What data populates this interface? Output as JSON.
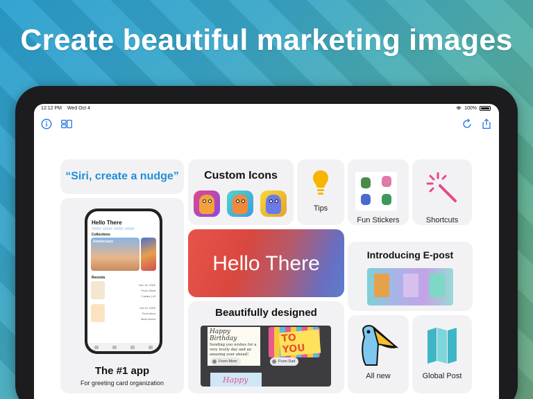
{
  "headline": "Create beautiful marketing images",
  "status": {
    "time": "12:12 PM",
    "date": "Wed Oct 4",
    "battery": "100%"
  },
  "toolbar": {
    "info": "info-icon",
    "sidebar": "sidebar-icon",
    "refresh": "refresh-icon",
    "share": "share-icon"
  },
  "cards": {
    "siri": {
      "text": "“Siri, create a nudge”"
    },
    "custom_icons": {
      "title": "Custom Icons"
    },
    "tips": {
      "label": "Tips"
    },
    "fun_stickers": {
      "label": "Fun Stickers"
    },
    "shortcuts": {
      "label": "Shortcuts"
    },
    "app": {
      "title": "The #1 app",
      "subtitle": "For greeting card organization"
    },
    "hello": {
      "text": "Hello There"
    },
    "epost": {
      "title": "Introducing E-post"
    },
    "designed": {
      "title": "Beautifully designed"
    },
    "all_new": {
      "label": "All new"
    },
    "global_post": {
      "label": "Global Post"
    }
  },
  "phone": {
    "title": "Hello There",
    "collections": "Collections",
    "anniversary": "Anniversary",
    "recents": "Recents",
    "date1": "Dec 10, 2022",
    "from1": "From Olivia",
    "meta1": "2 years | c3",
    "date2": "Oct 10, 2022",
    "from2": "From Mom",
    "meta2": "Most recent"
  },
  "design": {
    "bday_title": "Happy Birthday",
    "bday_body": "Sending you wishes for a very lovely day and an amazing year ahead!",
    "toyou": "TO YOU",
    "from_mom": "From Mom",
    "from_dad": "From Dad",
    "happy": "Happy"
  },
  "colors": {
    "accent": "#2e7ae6",
    "siri": "#1f8fd6",
    "card_bg": "#f2f2f4"
  }
}
